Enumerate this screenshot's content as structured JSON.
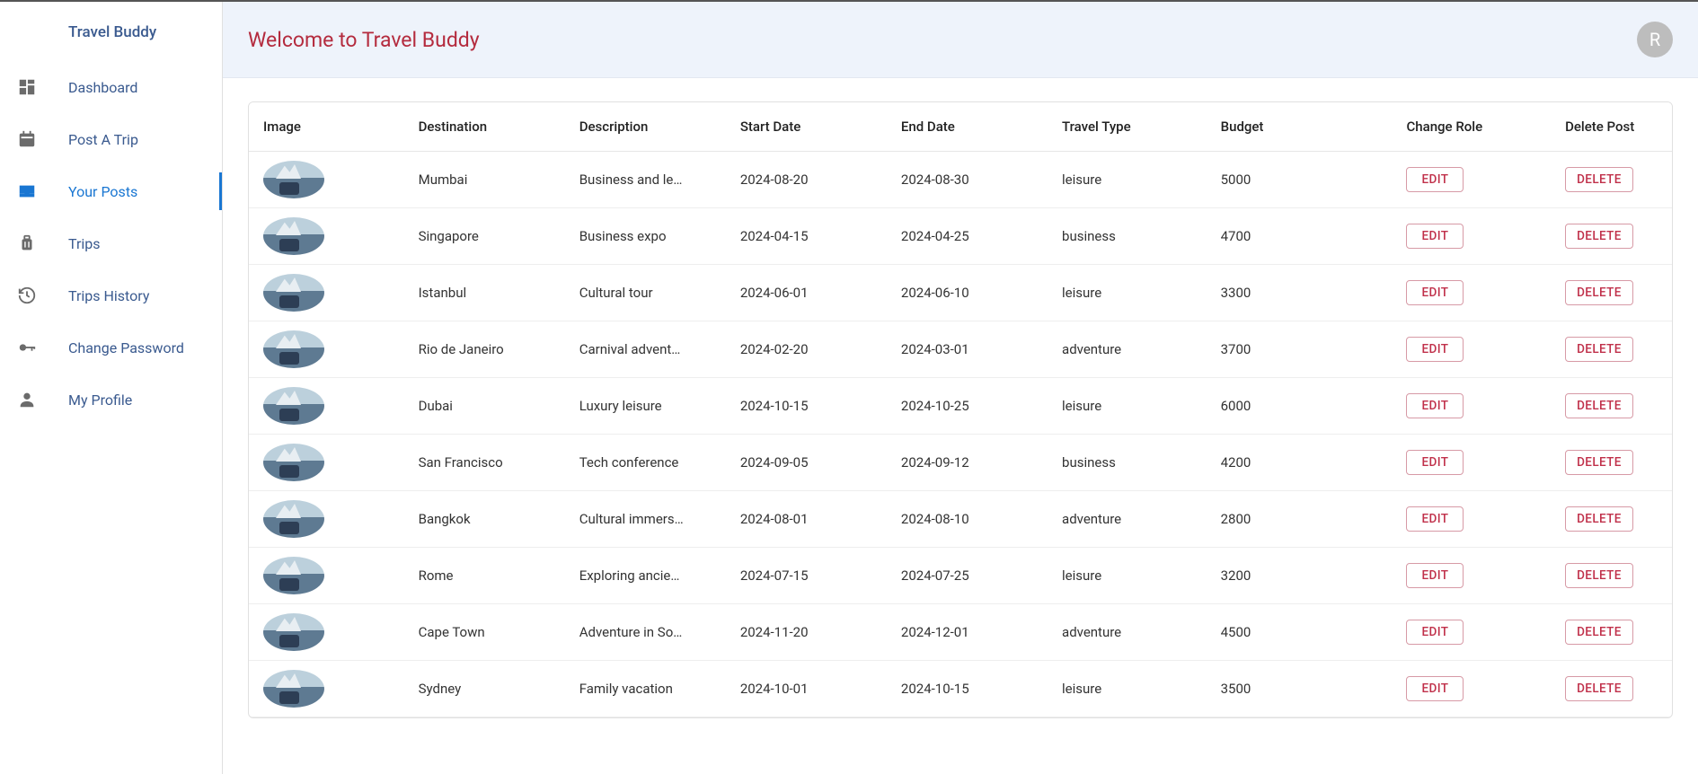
{
  "brand": "Travel Buddy",
  "sidebar": {
    "items": [
      {
        "label": "Dashboard",
        "icon": "dashboard"
      },
      {
        "label": "Post A Trip",
        "icon": "calendar"
      },
      {
        "label": "Your Posts",
        "icon": "inbox",
        "active": true
      },
      {
        "label": "Trips",
        "icon": "luggage"
      },
      {
        "label": "Trips History",
        "icon": "history"
      },
      {
        "label": "Change Password",
        "icon": "key"
      },
      {
        "label": "My Profile",
        "icon": "person"
      }
    ]
  },
  "header": {
    "title": "Welcome to Travel Buddy",
    "avatar_initial": "R"
  },
  "table": {
    "columns": [
      "Image",
      "Destination",
      "Description",
      "Start Date",
      "End Date",
      "Travel Type",
      "Budget",
      "Change Role",
      "Delete Post"
    ],
    "edit_label": "EDIT",
    "delete_label": "DELETE",
    "rows": [
      {
        "destination": "Mumbai",
        "description": "Business and le…",
        "start_date": "2024-08-20",
        "end_date": "2024-08-30",
        "travel_type": "leisure",
        "budget": "5000"
      },
      {
        "destination": "Singapore",
        "description": "Business expo",
        "start_date": "2024-04-15",
        "end_date": "2024-04-25",
        "travel_type": "business",
        "budget": "4700"
      },
      {
        "destination": "Istanbul",
        "description": "Cultural tour",
        "start_date": "2024-06-01",
        "end_date": "2024-06-10",
        "travel_type": "leisure",
        "budget": "3300"
      },
      {
        "destination": "Rio de Janeiro",
        "description": "Carnival advent…",
        "start_date": "2024-02-20",
        "end_date": "2024-03-01",
        "travel_type": "adventure",
        "budget": "3700"
      },
      {
        "destination": "Dubai",
        "description": "Luxury leisure",
        "start_date": "2024-10-15",
        "end_date": "2024-10-25",
        "travel_type": "leisure",
        "budget": "6000"
      },
      {
        "destination": "San Francisco",
        "description": "Tech conference",
        "start_date": "2024-09-05",
        "end_date": "2024-09-12",
        "travel_type": "business",
        "budget": "4200"
      },
      {
        "destination": "Bangkok",
        "description": "Cultural immers…",
        "start_date": "2024-08-01",
        "end_date": "2024-08-10",
        "travel_type": "adventure",
        "budget": "2800"
      },
      {
        "destination": "Rome",
        "description": "Exploring ancie…",
        "start_date": "2024-07-15",
        "end_date": "2024-07-25",
        "travel_type": "leisure",
        "budget": "3200"
      },
      {
        "destination": "Cape Town",
        "description": "Adventure in So…",
        "start_date": "2024-11-20",
        "end_date": "2024-12-01",
        "travel_type": "adventure",
        "budget": "4500"
      },
      {
        "destination": "Sydney",
        "description": "Family vacation",
        "start_date": "2024-10-01",
        "end_date": "2024-10-15",
        "travel_type": "leisure",
        "budget": "3500"
      }
    ]
  }
}
